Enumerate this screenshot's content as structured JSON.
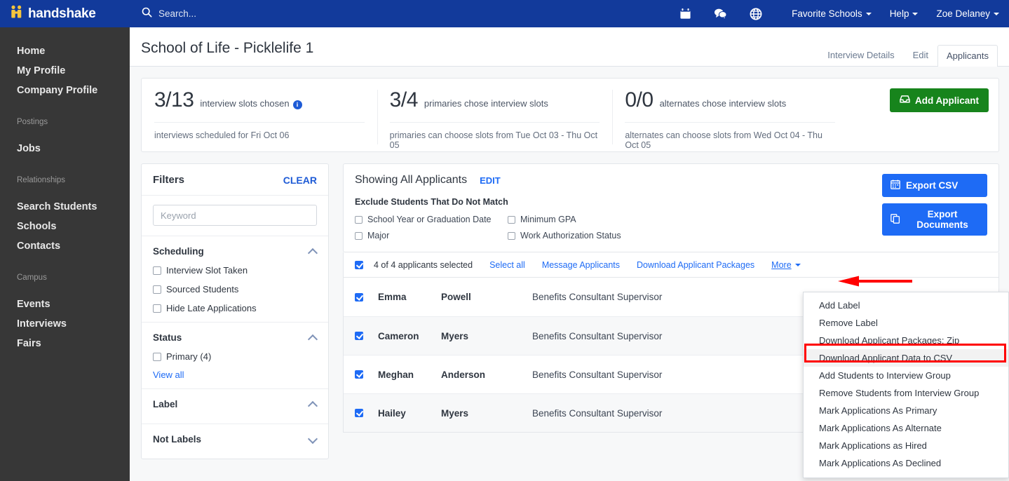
{
  "topnav": {
    "brand": "handshake",
    "search_placeholder": "Search...",
    "icons": [
      "calendar-icon",
      "messages-icon",
      "globe-icon"
    ],
    "links": [
      {
        "label": "Favorite Schools",
        "caret": true
      },
      {
        "label": "Help",
        "caret": true
      },
      {
        "label": "Zoe Delaney",
        "caret": true
      }
    ]
  },
  "sidebar": {
    "items": [
      {
        "label": "Home",
        "type": "item",
        "name": "home"
      },
      {
        "label": "My Profile",
        "type": "item",
        "name": "my-profile"
      },
      {
        "label": "Company Profile",
        "type": "item",
        "name": "company-profile"
      },
      {
        "label": "Postings",
        "type": "section",
        "name": "postings"
      },
      {
        "label": "Jobs",
        "type": "item",
        "name": "jobs"
      },
      {
        "label": "Relationships",
        "type": "section",
        "name": "relationships"
      },
      {
        "label": "Search Students",
        "type": "item",
        "name": "search-students"
      },
      {
        "label": "Schools",
        "type": "item",
        "name": "schools"
      },
      {
        "label": "Contacts",
        "type": "item",
        "name": "contacts"
      },
      {
        "label": "Campus",
        "type": "section",
        "name": "campus"
      },
      {
        "label": "Events",
        "type": "item",
        "name": "events"
      },
      {
        "label": "Interviews",
        "type": "item",
        "name": "interviews"
      },
      {
        "label": "Fairs",
        "type": "item",
        "name": "fairs"
      }
    ]
  },
  "page": {
    "title": "School of Life - Picklelife 1",
    "tabs": [
      {
        "label": "Interview Details",
        "active": false
      },
      {
        "label": "Edit",
        "active": false
      },
      {
        "label": "Applicants",
        "active": true
      }
    ]
  },
  "stats": {
    "items": [
      {
        "number": "3/13",
        "label": "interview slots chosen",
        "has_info": true,
        "sub": "interviews scheduled for Fri Oct 06"
      },
      {
        "number": "3/4",
        "label": "primaries chose interview slots",
        "has_info": false,
        "sub": "primaries can choose slots from Tue Oct 03 - Thu Oct 05"
      },
      {
        "number": "0/0",
        "label": "alternates chose interview slots",
        "has_info": false,
        "sub": "alternates can choose slots from Wed Oct 04 - Thu Oct 05"
      }
    ],
    "add_applicant_label": "Add Applicant"
  },
  "filters": {
    "title": "Filters",
    "clear_label": "CLEAR",
    "keyword_placeholder": "Keyword",
    "keyword_value": "",
    "sections": [
      {
        "title": "Scheduling",
        "collapsed": false,
        "options": [
          {
            "label": "Interview Slot Taken",
            "checked": false
          },
          {
            "label": "Sourced Students",
            "checked": false
          },
          {
            "label": "Hide Late Applications",
            "checked": false
          }
        ]
      },
      {
        "title": "Status",
        "collapsed": false,
        "options": [
          {
            "label": "Primary (4)",
            "checked": false
          }
        ],
        "view_all": "View all"
      },
      {
        "title": "Label",
        "collapsed": false,
        "options": []
      },
      {
        "title": "Not Labels",
        "collapsed": true,
        "options": []
      }
    ]
  },
  "applicants_panel": {
    "showing": "Showing All Applicants",
    "edit_label": "EDIT",
    "exclude_title": "Exclude Students That Do Not Match",
    "exclude_options": [
      {
        "label": "School Year or Graduation Date",
        "checked": false
      },
      {
        "label": "Minimum GPA",
        "checked": false
      },
      {
        "label": "Major",
        "checked": false
      },
      {
        "label": "Work Authorization Status",
        "checked": false
      }
    ],
    "export_csv_label": "Export CSV",
    "export_documents_label": "Export Documents",
    "toolbar": {
      "select_all_checked": true,
      "count_text": "4 of 4 applicants selected",
      "links": [
        "Select all",
        "Message Applicants",
        "Download Applicant Packages"
      ],
      "more_label": "More"
    },
    "rows": [
      {
        "checked": true,
        "first": "Emma",
        "last": "Powell",
        "job": "Benefits Consultant Supervisor"
      },
      {
        "checked": true,
        "first": "Cameron",
        "last": "Myers",
        "job": "Benefits Consultant Supervisor"
      },
      {
        "checked": true,
        "first": "Meghan",
        "last": "Anderson",
        "job": "Benefits Consultant Supervisor"
      },
      {
        "checked": true,
        "first": "Hailey",
        "last": "Myers",
        "job": "Benefits Consultant Supervisor"
      }
    ],
    "row_icons": [
      "calendar-icon",
      "graduation-cap-icon",
      "upload-circle-icon",
      "id-card-icon"
    ]
  },
  "more_menu": {
    "items": [
      {
        "label": "Add Label",
        "highlighted": false
      },
      {
        "label": "Remove Label",
        "highlighted": false
      },
      {
        "label": "Download Applicant Packages: Zip",
        "highlighted": false
      },
      {
        "label": "Download Applicant Data to CSV",
        "highlighted": true
      },
      {
        "label": "Add Students to Interview Group",
        "highlighted": false
      },
      {
        "label": "Remove Students from Interview Group",
        "highlighted": false
      },
      {
        "label": "Mark Applications As Primary",
        "highlighted": false
      },
      {
        "label": "Mark Applications As Alternate",
        "highlighted": false
      },
      {
        "label": "Mark Applications as Hired",
        "highlighted": false
      },
      {
        "label": "Mark Applications As Declined",
        "highlighted": false
      }
    ]
  },
  "annotations": {
    "highlight_color": "#ff0000",
    "arrow_color": "#ff0000"
  },
  "colors": {
    "nav_blue": "#123a9b",
    "sidebar_dark": "#373737",
    "accent_blue": "#1e6bf5",
    "green": "#17841c",
    "logo_yellow": "#f5c53d"
  }
}
